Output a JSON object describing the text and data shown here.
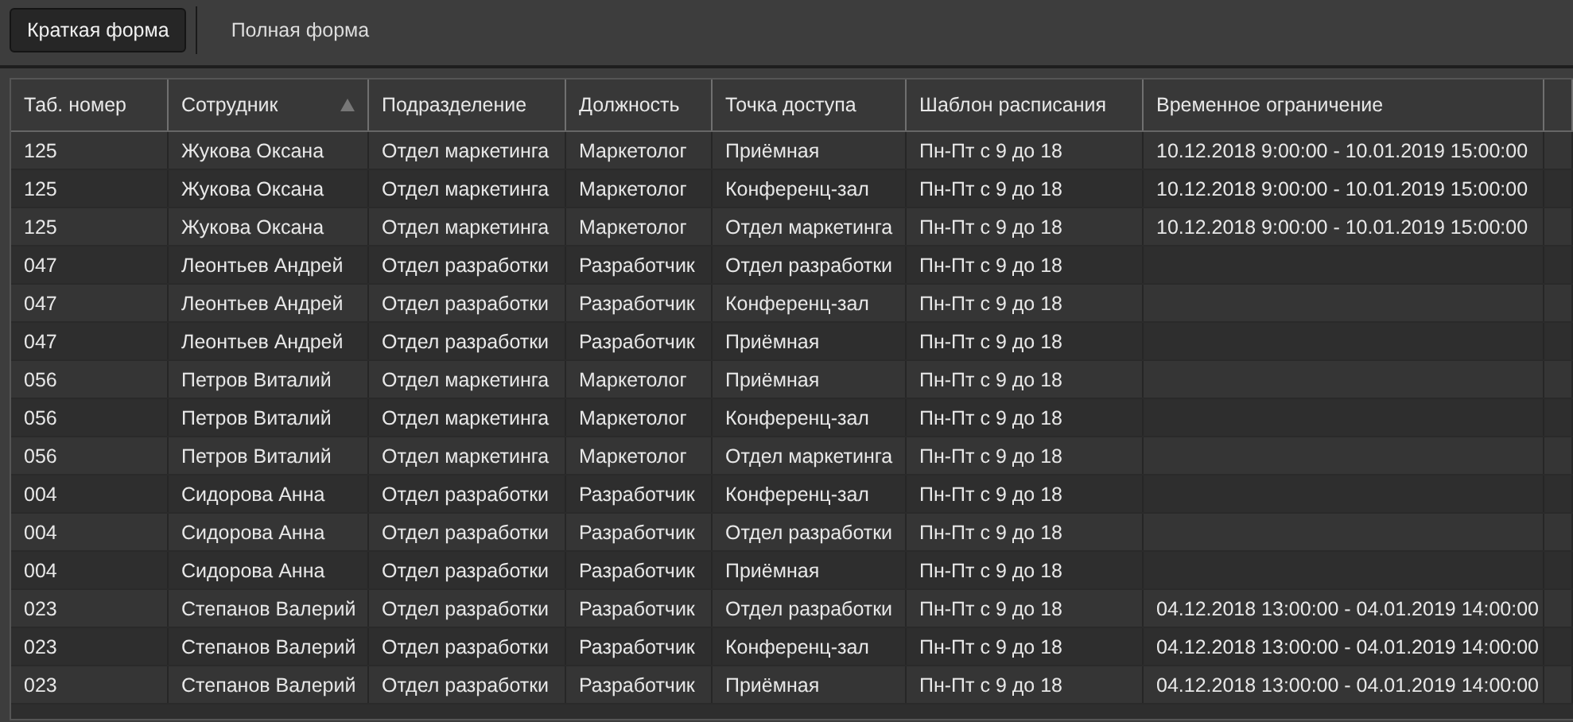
{
  "tabs": [
    {
      "label": "Краткая форма",
      "selected": true
    },
    {
      "label": "Полная форма",
      "selected": false
    }
  ],
  "table": {
    "columns": [
      {
        "label": "Таб. номер",
        "sorted": false
      },
      {
        "label": "Сотрудник",
        "sorted": true
      },
      {
        "label": "Подразделение",
        "sorted": false
      },
      {
        "label": "Должность",
        "sorted": false
      },
      {
        "label": "Точка доступа",
        "sorted": false
      },
      {
        "label": "Шаблон расписания",
        "sorted": false
      },
      {
        "label": "Временное ограничение",
        "sorted": false
      }
    ],
    "rows": [
      [
        "125",
        "Жукова Оксана",
        "Отдел маркетинга",
        "Маркетолог",
        "Приёмная",
        "Пн-Пт с 9 до 18",
        "10.12.2018 9:00:00 - 10.01.2019 15:00:00"
      ],
      [
        "125",
        "Жукова Оксана",
        "Отдел маркетинга",
        "Маркетолог",
        "Конференц-зал",
        "Пн-Пт с 9 до 18",
        "10.12.2018 9:00:00 - 10.01.2019 15:00:00"
      ],
      [
        "125",
        "Жукова Оксана",
        "Отдел маркетинга",
        "Маркетолог",
        "Отдел маркетинга",
        "Пн-Пт с 9 до 18",
        "10.12.2018 9:00:00 - 10.01.2019 15:00:00"
      ],
      [
        "047",
        "Леонтьев Андрей",
        "Отдел разработки",
        "Разработчик",
        "Отдел разработки",
        "Пн-Пт с 9 до 18",
        ""
      ],
      [
        "047",
        "Леонтьев Андрей",
        "Отдел разработки",
        "Разработчик",
        "Конференц-зал",
        "Пн-Пт с 9 до 18",
        ""
      ],
      [
        "047",
        "Леонтьев Андрей",
        "Отдел разработки",
        "Разработчик",
        "Приёмная",
        "Пн-Пт с 9 до 18",
        ""
      ],
      [
        "056",
        "Петров Виталий",
        "Отдел маркетинга",
        "Маркетолог",
        "Приёмная",
        "Пн-Пт с 9 до 18",
        ""
      ],
      [
        "056",
        "Петров Виталий",
        "Отдел маркетинга",
        "Маркетолог",
        "Конференц-зал",
        "Пн-Пт с 9 до 18",
        ""
      ],
      [
        "056",
        "Петров Виталий",
        "Отдел маркетинга",
        "Маркетолог",
        "Отдел маркетинга",
        "Пн-Пт с 9 до 18",
        ""
      ],
      [
        "004",
        "Сидорова Анна",
        "Отдел разработки",
        "Разработчик",
        "Конференц-зал",
        "Пн-Пт с 9 до 18",
        ""
      ],
      [
        "004",
        "Сидорова Анна",
        "Отдел разработки",
        "Разработчик",
        "Отдел разработки",
        "Пн-Пт с 9 до 18",
        ""
      ],
      [
        "004",
        "Сидорова Анна",
        "Отдел разработки",
        "Разработчик",
        "Приёмная",
        "Пн-Пт с 9 до 18",
        ""
      ],
      [
        "023",
        "Степанов Валерий",
        "Отдел разработки",
        "Разработчик",
        "Отдел разработки",
        "Пн-Пт с 9 до 18",
        "04.12.2018 13:00:00 - 04.01.2019 14:00:00"
      ],
      [
        "023",
        "Степанов Валерий",
        "Отдел разработки",
        "Разработчик",
        "Конференц-зал",
        "Пн-Пт с 9 до 18",
        "04.12.2018 13:00:00 - 04.01.2019 14:00:00"
      ],
      [
        "023",
        "Степанов Валерий",
        "Отдел разработки",
        "Разработчик",
        "Приёмная",
        "Пн-Пт с 9 до 18",
        "04.12.2018 13:00:00 - 04.01.2019 14:00:00"
      ]
    ]
  }
}
